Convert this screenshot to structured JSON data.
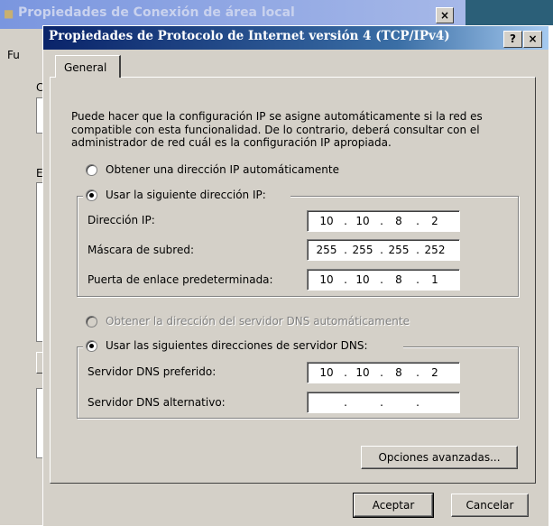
{
  "background_window": {
    "title": "Propiedades de Conexión de área local",
    "close_glyph": "×",
    "tab_fragment": "Fu",
    "label_fragment_1": "C",
    "label_fragment_2": "E"
  },
  "dialog": {
    "title": "Propiedades de Protocolo de Internet versión 4 (TCP/IPv4)",
    "help_glyph": "?",
    "close_glyph": "×",
    "tab": "General",
    "intro": "Puede hacer que la configuración IP se asigne automáticamente si la red es compatible con esta funcionalidad. De lo contrario, deberá consultar con el administrador de red cuál es la configuración IP apropiada.",
    "ip_auto_option": "Obtener una dirección IP automáticamente",
    "ip_manual_option": "Usar la siguiente dirección IP:",
    "fields": {
      "ip_label": "Dirección IP:",
      "ip": [
        "10",
        "10",
        "8",
        "2"
      ],
      "mask_label": "Máscara de subred:",
      "mask": [
        "255",
        "255",
        "255",
        "252"
      ],
      "gateway_label": "Puerta de enlace predeterminada:",
      "gateway": [
        "10",
        "10",
        "8",
        "1"
      ]
    },
    "dns_auto_option": "Obtener la dirección del servidor DNS automáticamente",
    "dns_manual_option": "Usar las siguientes direcciones de servidor DNS:",
    "dns": {
      "preferred_label": "Servidor DNS preferido:",
      "preferred": [
        "10",
        "10",
        "8",
        "2"
      ],
      "alternate_label": "Servidor DNS alternativo:",
      "alternate": [
        "",
        "",
        "",
        ""
      ]
    },
    "ip_selected": "manual",
    "dns_selected": "manual",
    "dns_auto_enabled": false,
    "advanced_button": "Opciones avanzadas...",
    "ok_button": "Aceptar",
    "cancel_button": "Cancelar",
    "dot": "."
  },
  "colors": {
    "dialog_face": "#d4d0c8",
    "title_active": "#0a246a",
    "title_inactive": "#7a96df"
  }
}
